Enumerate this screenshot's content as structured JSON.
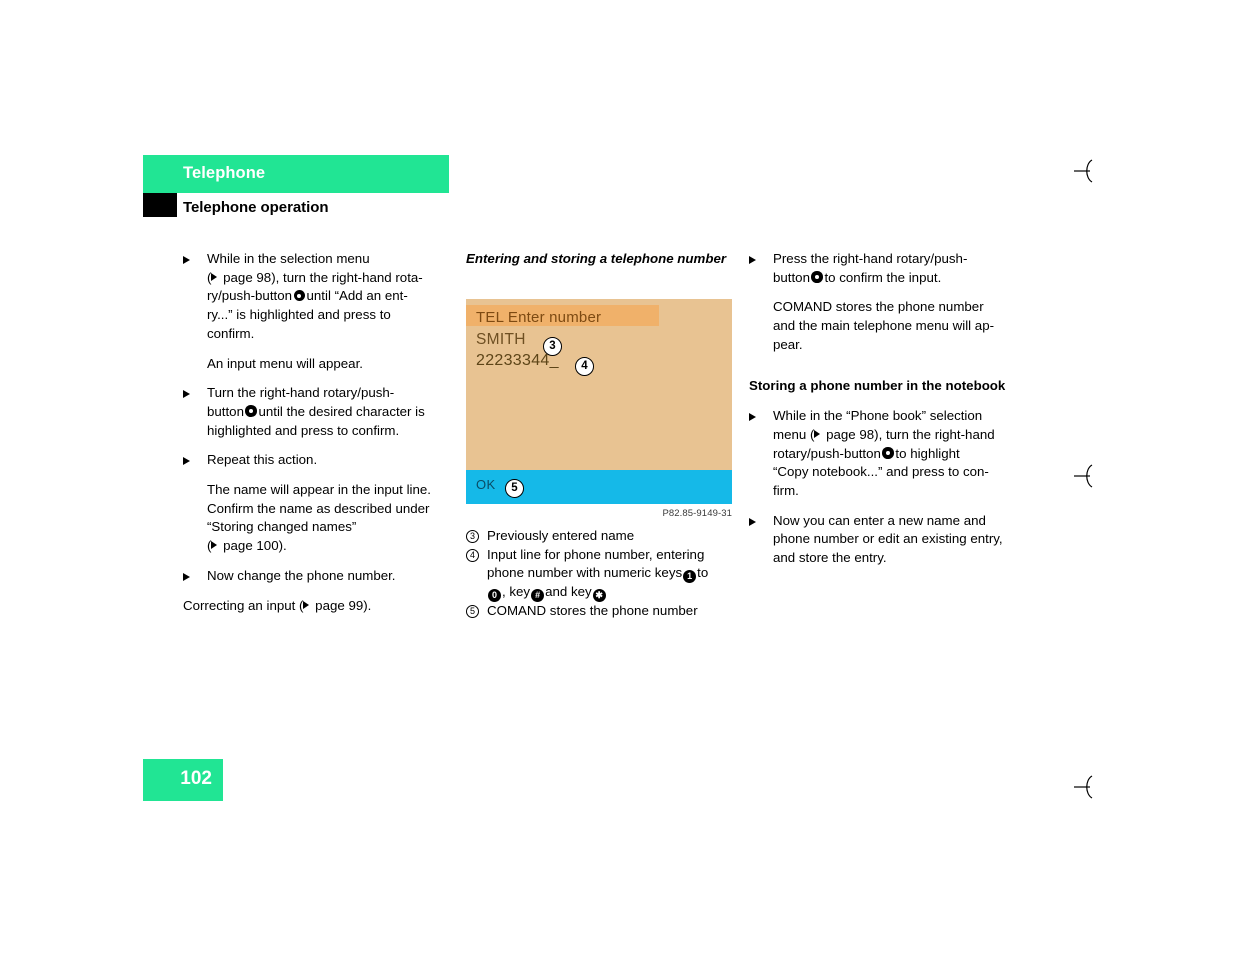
{
  "header": {
    "chapter": "Telephone",
    "section": "Telephone operation"
  },
  "page_number": "102",
  "column1": {
    "step1_line1": "While in the selection menu",
    "step1_line2_a": "(",
    "step1_line2_b": " page 98), turn the right-hand rota-",
    "step1_line3_a": "ry/push-button",
    "step1_line3_b": "until “Add an ent-",
    "step1_line4": "ry...” is highlighted and press to",
    "step1_line5": "confirm.",
    "note1": "An input menu will appear.",
    "step2_line1": "Turn the right-hand rotary/push-",
    "step2_line2_a": "button",
    "step2_line2_b": "until the desired character is",
    "step2_line3": "highlighted and press to confirm.",
    "step3": "Repeat this action.",
    "note2_line1": "The name will appear in the input line.",
    "note2_line2": "Confirm the name as described under",
    "note2_line3": "“Storing changed names”",
    "note2_line4_a": "(",
    "note2_line4_b": " page 100).",
    "step4": "Now change the phone number.",
    "closing_a": "Correcting an input (",
    "closing_b": " page 99)."
  },
  "column2": {
    "subheading": "Entering and storing a telephone number",
    "screen": {
      "title": "TEL Enter number",
      "name": "SMITH",
      "number": "22233344_",
      "ok_label": "OK"
    },
    "callouts": {
      "three": "3",
      "four": "4",
      "five": "5"
    },
    "figure_caption": "P82.85-9149-31",
    "legend": {
      "item3_num": "3",
      "item3_text": "Previously entered name",
      "item4_num": "4",
      "item4_line1": "Input line for phone number, entering",
      "item4_line2_a": "phone number with numeric keys",
      "item4_key_1": "1",
      "item4_line2_b": "to",
      "item4_key_0": "0",
      "item4_line3_a": ", key",
      "item4_key_hash": "#",
      "item4_line3_b": "and key",
      "item4_key_star": "✱",
      "item5_num": "5",
      "item5_text": "COMAND stores the phone number"
    }
  },
  "column3": {
    "step1_line1": "Press the right-hand rotary/push-",
    "step1_line2_a": "button",
    "step1_line2_b": "to confirm the input.",
    "note1_line1": "COMAND stores the phone number",
    "note1_line2": "and the main telephone menu will ap-",
    "note1_line3": "pear.",
    "subheading": "Storing a phone number in the notebook",
    "step2_line1": "While in the “Phone book” selection",
    "step2_line2_a": "menu (",
    "step2_line2_b": " page 98), turn the right-hand",
    "step2_line3_a": "rotary/push-button",
    "step2_line3_b": "to highlight",
    "step2_line4": "“Copy notebook...” and press to con-",
    "step2_line5": "firm.",
    "step3_line1": "Now you can enter a new name and",
    "step3_line2": "phone number or edit an existing entry,",
    "step3_line3": "and store the entry."
  },
  "colors": {
    "accent_green": "#21e594",
    "screen_bg": "#e8c392",
    "screen_titlebar": "#f0b16a",
    "screen_footerbar": "#15b9e8"
  }
}
